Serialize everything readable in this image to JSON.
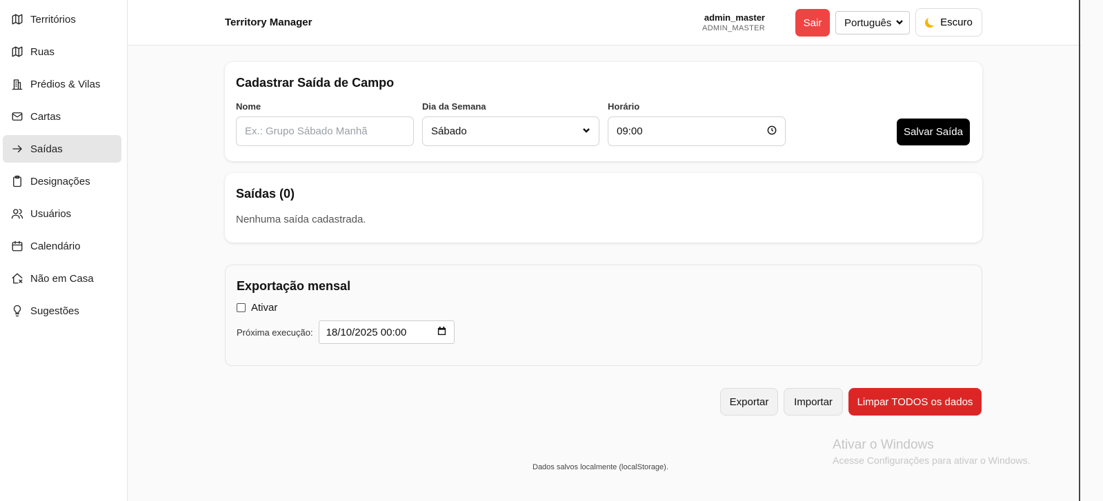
{
  "sidebar": {
    "items": [
      {
        "label": "Territórios",
        "icon": "map-icon"
      },
      {
        "label": "Ruas",
        "icon": "map-icon"
      },
      {
        "label": "Prédios & Vilas",
        "icon": "building-icon"
      },
      {
        "label": "Cartas",
        "icon": "mail-icon"
      },
      {
        "label": "Saídas",
        "icon": "arrow-right-icon",
        "active": true
      },
      {
        "label": "Designações",
        "icon": "clipboard-icon"
      },
      {
        "label": "Usuários",
        "icon": "users-icon"
      },
      {
        "label": "Calendário",
        "icon": "calendar-icon"
      },
      {
        "label": "Não em Casa",
        "icon": "house-x-icon"
      },
      {
        "label": "Sugestões",
        "icon": "lightbulb-icon"
      }
    ]
  },
  "header": {
    "title": "Territory Manager",
    "user_name": "admin_master",
    "user_role": "ADMIN_MASTER",
    "logout_label": "Sair",
    "language": "Português",
    "theme_label": "Escuro"
  },
  "form": {
    "title": "Cadastrar Saída de Campo",
    "name_label": "Nome",
    "name_placeholder": "Ex.: Grupo Sábado Manhã",
    "weekday_label": "Dia da Semana",
    "weekday_value": "Sábado",
    "time_label": "Horário",
    "time_value": "09:00",
    "save_label": "Salvar Saída"
  },
  "list": {
    "title": "Saídas (0)",
    "empty": "Nenhuma saída cadastrada."
  },
  "export": {
    "title": "Exportação mensal",
    "enable_label": "Ativar",
    "next_label": "Próxima execução:",
    "next_value": "18/10/2025 00:00"
  },
  "actions": {
    "export_label": "Exportar",
    "import_label": "Importar",
    "clear_label": "Limpar TODOS os dados"
  },
  "footer": {
    "note": "Dados salvos localmente (localStorage)."
  },
  "windows_watermark": {
    "title": "Ativar o Windows",
    "subtitle": "Acesse Configurações para ativar o Windows."
  },
  "colors": {
    "danger": "#dc2626",
    "logout": "#ef4444",
    "primary": "#000000"
  }
}
